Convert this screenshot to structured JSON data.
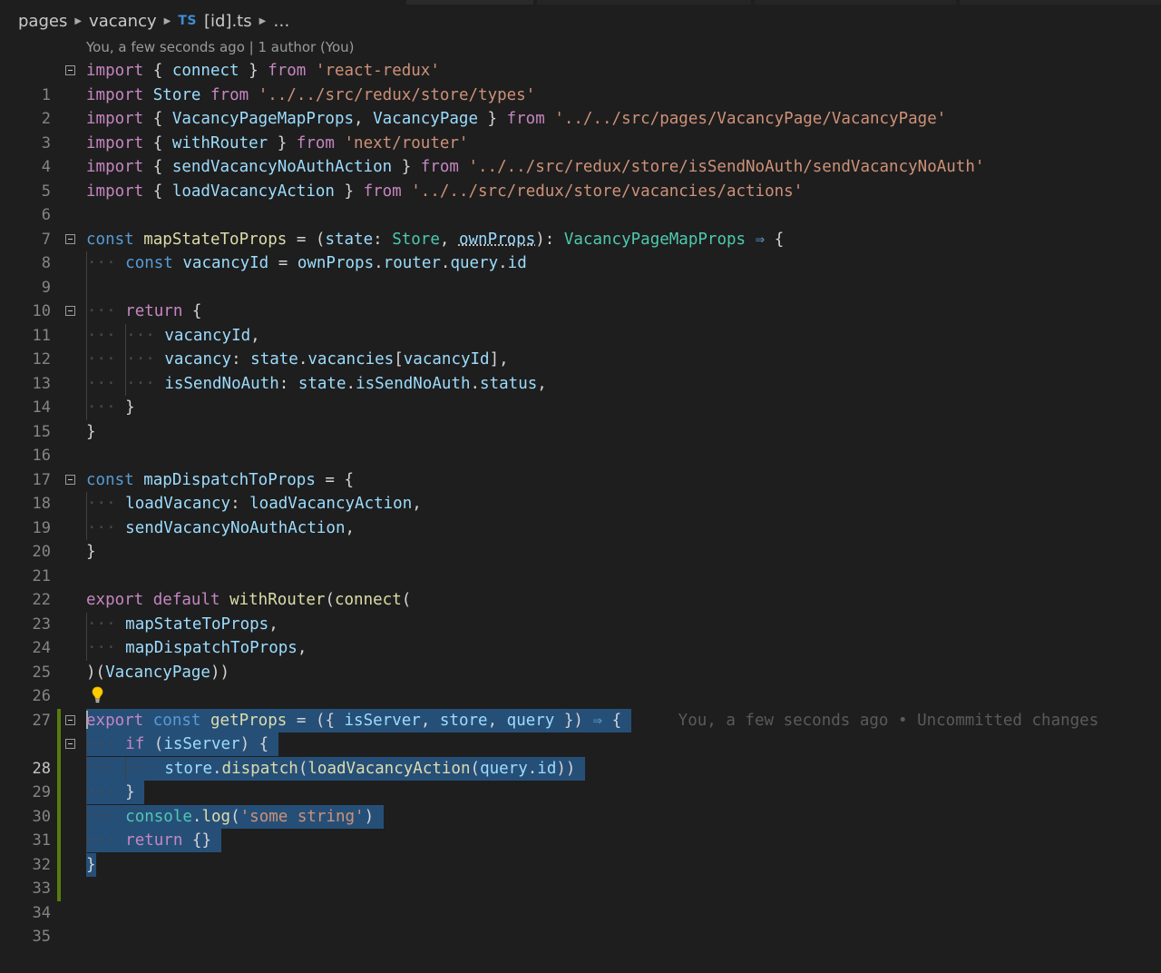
{
  "breadcrumb": {
    "parts": [
      "pages",
      "vacancy"
    ],
    "lang_badge": "TS",
    "file": "[id].ts",
    "ellipsis": "…"
  },
  "blame_header": "You, a few seconds ago | 1 author (You)",
  "inline_blame": "You, a few seconds ago • Uncommitted changes",
  "line_numbers": [
    "1",
    "2",
    "3",
    "4",
    "5",
    "6",
    "7",
    "8",
    "9",
    "10",
    "11",
    "12",
    "13",
    "14",
    "15",
    "16",
    "17",
    "18",
    "19",
    "20",
    "21",
    "22",
    "23",
    "24",
    "25",
    "26",
    "27",
    "28",
    "29",
    "30",
    "31",
    "32",
    "33",
    "34",
    "35"
  ],
  "code": {
    "l1": [
      "import",
      " { ",
      "connect",
      " } ",
      "from",
      " ",
      "'react-redux'"
    ],
    "l2": [
      "import",
      " ",
      "Store",
      " ",
      "from",
      " ",
      "'../../src/redux/store/types'"
    ],
    "l3": [
      "import",
      " { ",
      "VacancyPageMapProps",
      ", ",
      "VacancyPage",
      " } ",
      "from",
      " ",
      "'../../src/pages/VacancyPage/VacancyPage'"
    ],
    "l4": [
      "import",
      " { ",
      "withRouter",
      " } ",
      "from",
      " ",
      "'next/router'"
    ],
    "l5": [
      "import",
      " { ",
      "sendVacancyNoAuthAction",
      " } ",
      "from",
      " ",
      "'../../src/redux/store/isSendNoAuth/sendVacancyNoAuth'"
    ],
    "l6": [
      "import",
      " { ",
      "loadVacancyAction",
      " } ",
      "from",
      " ",
      "'../../src/redux/store/vacancies/actions'"
    ],
    "l8": [
      "const",
      " ",
      "mapStateToProps",
      " = (",
      "state",
      ": ",
      "Store",
      ", ",
      "ownProps",
      "): ",
      "VacancyPageMapProps",
      " ",
      "⇒",
      " {"
    ],
    "l9": [
      "const",
      " ",
      "vacancyId",
      " = ",
      "ownProps",
      ".",
      "router",
      ".",
      "query",
      ".",
      "id"
    ],
    "l11": [
      "return",
      " {"
    ],
    "l12": [
      "vacancyId",
      ","
    ],
    "l13": [
      "vacancy",
      ": ",
      "state",
      ".",
      "vacancies",
      "[",
      "vacancyId",
      "],"
    ],
    "l14": [
      "isSendNoAuth",
      ": ",
      "state",
      ".",
      "isSendNoAuth",
      ".",
      "status",
      ","
    ],
    "l15": [
      "}"
    ],
    "l16": [
      "}"
    ],
    "l18": [
      "const",
      " ",
      "mapDispatchToProps",
      " = {"
    ],
    "l19": [
      "loadVacancy",
      ": ",
      "loadVacancyAction",
      ","
    ],
    "l20": [
      "sendVacancyNoAuthAction",
      ","
    ],
    "l21": [
      "}"
    ],
    "l23": [
      "export",
      " ",
      "default",
      " ",
      "withRouter",
      "(",
      "connect",
      "("
    ],
    "l24": [
      "mapStateToProps",
      ","
    ],
    "l25": [
      "mapDispatchToProps",
      ","
    ],
    "l26": [
      ")(",
      "VacancyPage",
      "))"
    ],
    "l28": [
      "export",
      " ",
      "const",
      " ",
      "getProps",
      " = ({ ",
      "isServer",
      ", ",
      "store",
      ", ",
      "query",
      " }) ",
      "⇒",
      " {"
    ],
    "l29": [
      "if",
      " (",
      "isServer",
      ") {"
    ],
    "l30": [
      "store",
      ".",
      "dispatch",
      "(",
      "loadVacancyAction",
      "(",
      "query",
      ".",
      "id",
      "))"
    ],
    "l31": [
      "}"
    ],
    "l32": [
      "console",
      ".",
      "log",
      "(",
      "'some string'",
      ")"
    ],
    "l33": [
      "return",
      " {}"
    ],
    "l34": [
      "}"
    ]
  },
  "icons": {
    "lightbulb": "lightbulb-icon",
    "fold": "fold-collapse-icon",
    "chevron": "chevron-right-icon"
  },
  "colors": {
    "background": "#1e1e1e",
    "selection": "#264f78",
    "git_added": "#587c0c",
    "keyword": "#c586c0",
    "string": "#ce9178"
  }
}
